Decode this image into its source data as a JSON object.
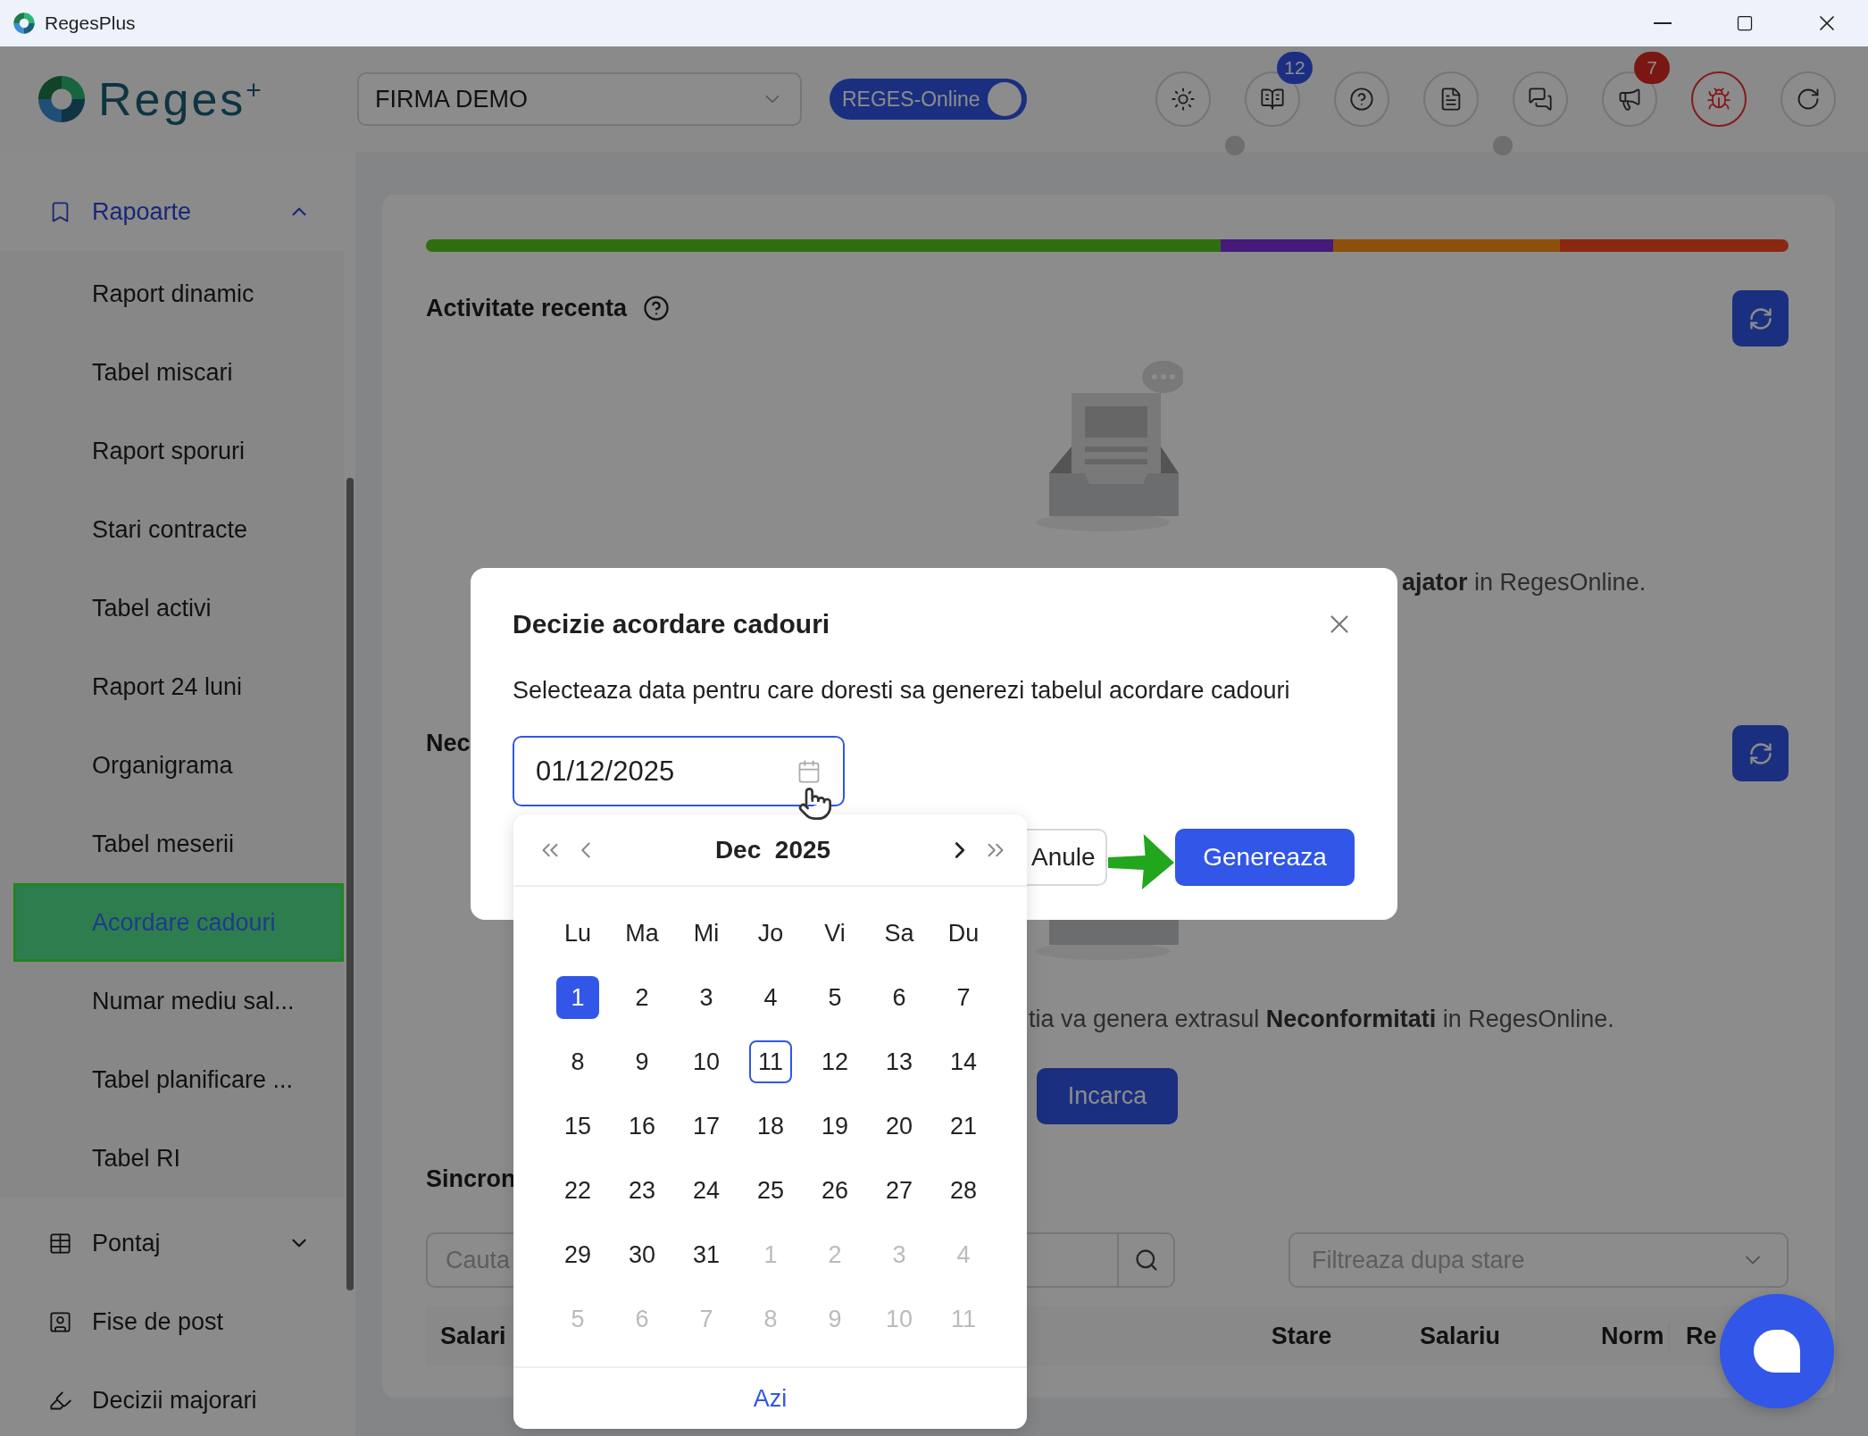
{
  "window": {
    "title": "RegesPlus"
  },
  "header": {
    "logo": "Reges$^{+}$",
    "company": "FIRMA DEMO",
    "mode_toggle": {
      "label": "REGES-Online",
      "on": true
    },
    "toolbar": [
      {
        "kind": "sun",
        "alert": false,
        "indicator": false
      },
      {
        "kind": "book",
        "badge": "12",
        "alert": false,
        "indicator": true
      },
      {
        "kind": "help",
        "alert": false,
        "indicator": false
      },
      {
        "kind": "document",
        "alert": false,
        "indicator": false
      },
      {
        "kind": "chat",
        "alert": false,
        "indicator": true
      },
      {
        "kind": "megaphone",
        "badge": "7",
        "alert": false,
        "indicator": false
      },
      {
        "kind": "bug",
        "alert": true,
        "indicator": false
      },
      {
        "kind": "circular-arrow",
        "alert": false,
        "indicator": false
      }
    ]
  },
  "sidebar": {
    "groups": [
      {
        "label": "Rapoarte",
        "kind": "group",
        "expanded": true,
        "children": [
          {
            "label": "Raport dinamic",
            "selected": false
          },
          {
            "label": "Tabel miscari",
            "selected": false
          },
          {
            "label": "Raport sporuri",
            "selected": false
          },
          {
            "label": "Stari contracte",
            "selected": false
          },
          {
            "label": "Tabel activi",
            "selected": false
          },
          {
            "label": "Raport 24 luni",
            "selected": false
          },
          {
            "label": "Organigrama",
            "selected": false
          },
          {
            "label": "Tabel meserii",
            "selected": false
          },
          {
            "label": "Acordare cadouri",
            "selected": true
          },
          {
            "label": "Numar mediu sal...",
            "selected": false
          },
          {
            "label": "Tabel planificare ...",
            "selected": false
          },
          {
            "label": "Tabel RI",
            "selected": false
          }
        ]
      },
      {
        "label": "Pontaj",
        "kind": "group",
        "expanded": false
      },
      {
        "label": "Fise de post",
        "kind": "link",
        "expanded": false
      },
      {
        "label": "Decizii majorari",
        "kind": "link",
        "expanded": false
      }
    ]
  },
  "main": {
    "recent_activity": {
      "title": "Activitate recenta",
      "text": "**ajator** in RegesOnline."
    },
    "section_2": {
      "title": "Nec",
      "text": "tia va genera extrasul **Neconformitati** in RegesOnline.",
      "button": "Incarca"
    },
    "section_3": {
      "title": "Sincron",
      "search": {
        "placeholder": "Cauta"
      },
      "filter": {
        "placeholder": "Filtreaza dupa stare"
      },
      "table": {
        "columns": [
          "Salari",
          "Stare",
          "Salariu",
          "Norm",
          "Re"
        ]
      }
    }
  },
  "dialog": {
    "title": "Decizie acordare cadouri",
    "description": "Selecteaza data pentru care doresti sa generezi tabelul acordare cadouri",
    "date_field": {
      "value": "01/12/2025"
    },
    "buttons": [
      {
        "label": "Anule",
        "kind": "secondary"
      },
      {
        "label": "Genereaza",
        "kind": "primary"
      }
    ],
    "calendar": {
      "month": "Dec",
      "year": "2025",
      "weekdays": [
        "Lu",
        "Ma",
        "Mi",
        "Jo",
        "Vi",
        "Sa",
        "Du"
      ],
      "weeks": [
        [
          {
            "day": "1",
            "selected": true,
            "today": false,
            "outside": false
          },
          {
            "day": "2",
            "selected": false,
            "today": false,
            "outside": false
          },
          {
            "day": "3",
            "selected": false,
            "today": false,
            "outside": false
          },
          {
            "day": "4",
            "selected": false,
            "today": false,
            "outside": false
          },
          {
            "day": "5",
            "selected": false,
            "today": false,
            "outside": false
          },
          {
            "day": "6",
            "selected": false,
            "today": false,
            "outside": false
          },
          {
            "day": "7",
            "selected": false,
            "today": false,
            "outside": false
          }
        ],
        [
          {
            "day": "8",
            "selected": false,
            "today": false,
            "outside": false
          },
          {
            "day": "9",
            "selected": false,
            "today": false,
            "outside": false
          },
          {
            "day": "10",
            "selected": false,
            "today": false,
            "outside": false
          },
          {
            "day": "11",
            "selected": false,
            "today": true,
            "outside": false
          },
          {
            "day": "12",
            "selected": false,
            "today": false,
            "outside": false
          },
          {
            "day": "13",
            "selected": false,
            "today": false,
            "outside": false
          },
          {
            "day": "14",
            "selected": false,
            "today": false,
            "outside": false
          }
        ],
        [
          {
            "day": "15",
            "selected": false,
            "today": false,
            "outside": false
          },
          {
            "day": "16",
            "selected": false,
            "today": false,
            "outside": false
          },
          {
            "day": "17",
            "selected": false,
            "today": false,
            "outside": false
          },
          {
            "day": "18",
            "selected": false,
            "today": false,
            "outside": false
          },
          {
            "day": "19",
            "selected": false,
            "today": false,
            "outside": false
          },
          {
            "day": "20",
            "selected": false,
            "today": false,
            "outside": false
          },
          {
            "day": "21",
            "selected": false,
            "today": false,
            "outside": false
          }
        ],
        [
          {
            "day": "22",
            "selected": false,
            "today": false,
            "outside": false
          },
          {
            "day": "23",
            "selected": false,
            "today": false,
            "outside": false
          },
          {
            "day": "24",
            "selected": false,
            "today": false,
            "outside": false
          },
          {
            "day": "25",
            "selected": false,
            "today": false,
            "outside": false
          },
          {
            "day": "26",
            "selected": false,
            "today": false,
            "outside": false
          },
          {
            "day": "27",
            "selected": false,
            "today": false,
            "outside": false
          },
          {
            "day": "28",
            "selected": false,
            "today": false,
            "outside": false
          }
        ],
        [
          {
            "day": "29",
            "selected": false,
            "today": false,
            "outside": false
          },
          {
            "day": "30",
            "selected": false,
            "today": false,
            "outside": false
          },
          {
            "day": "31",
            "selected": false,
            "today": false,
            "outside": false
          },
          {
            "day": "1",
            "selected": false,
            "today": false,
            "outside": true
          },
          {
            "day": "2",
            "selected": false,
            "today": false,
            "outside": true
          },
          {
            "day": "3",
            "selected": false,
            "today": false,
            "outside": true
          },
          {
            "day": "4",
            "selected": false,
            "today": false,
            "outside": true
          }
        ],
        [
          {
            "day": "5",
            "selected": false,
            "today": false,
            "outside": true
          },
          {
            "day": "6",
            "selected": false,
            "today": false,
            "outside": true
          },
          {
            "day": "7",
            "selected": false,
            "today": false,
            "outside": true
          },
          {
            "day": "8",
            "selected": false,
            "today": false,
            "outside": true
          },
          {
            "day": "9",
            "selected": false,
            "today": false,
            "outside": true
          },
          {
            "day": "10",
            "selected": false,
            "today": false,
            "outside": true
          },
          {
            "day": "11",
            "selected": false,
            "today": false,
            "outside": true
          }
        ]
      ],
      "today_button": "Azi"
    }
  }
}
